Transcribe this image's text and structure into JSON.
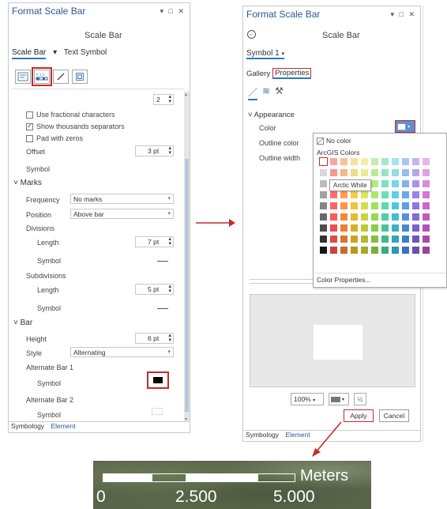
{
  "left_panel": {
    "title": "Format Scale Bar",
    "window_controls": "▾ □ ✕",
    "subtitle": "Scale Bar",
    "tab_scale_bar": "Scale Bar",
    "tab_text_symbol": "Text Symbol",
    "decimal_value": "2",
    "use_fractional": "Use fractional characters",
    "show_thousands": "Show thousands separators",
    "pad_zeros": "Pad with zeros",
    "offset_label": "Offset",
    "offset_value": "3 pt",
    "symbol_label": "Symbol",
    "marks_header": "Marks",
    "frequency_label": "Frequency",
    "frequency_value": "No marks",
    "position_label": "Position",
    "position_value": "Above bar",
    "divisions_label": "Divisions",
    "length_label": "Length",
    "div_length_value": "7 pt",
    "div_symbol_label": "Symbol",
    "subdivisions_label": "Subdivisions",
    "sub_length_label": "Length",
    "sub_length_value": "5 pt",
    "sub_symbol_label": "Symbol",
    "bar_header": "Bar",
    "height_label": "Height",
    "height_value": "6 pt",
    "style_label": "Style",
    "style_value": "Alternating",
    "alt_bar1_label": "Alternate Bar 1",
    "alt_bar1_symbol": "Symbol",
    "alt_bar2_label": "Alternate Bar 2",
    "alt_bar2_symbol": "Symbol",
    "bottom_tab1": "Symbology",
    "bottom_tab2": "Element"
  },
  "right_panel": {
    "title": "Format Scale Bar",
    "window_controls": "▾ □ ✕",
    "subtitle": "Scale Bar",
    "symbol_dropdown": "Symbol 1",
    "tab_gallery": "Gallery",
    "tab_properties": "Properties",
    "appearance_header": "Appearance",
    "color_label": "Color",
    "outline_color_label": "Outline color",
    "outline_width_label": "Outline width",
    "zoom_value": "100%",
    "apply_button": "Apply",
    "cancel_button": "Cancel",
    "bottom_tab1": "Symbology",
    "bottom_tab2": "Element"
  },
  "color_popup": {
    "no_color": "No color",
    "palette_title": "ArcGIS Colors",
    "tooltip": "Arctic White",
    "footer": "Color Properties..."
  },
  "scale_bar_preview": {
    "unit": "Meters",
    "tick_labels": [
      "0",
      "2.500",
      "5.000"
    ]
  },
  "colors": {
    "accent_red": "#c42b2b",
    "title_blue": "#2b5797",
    "tab_blue": "#2b77c7"
  }
}
